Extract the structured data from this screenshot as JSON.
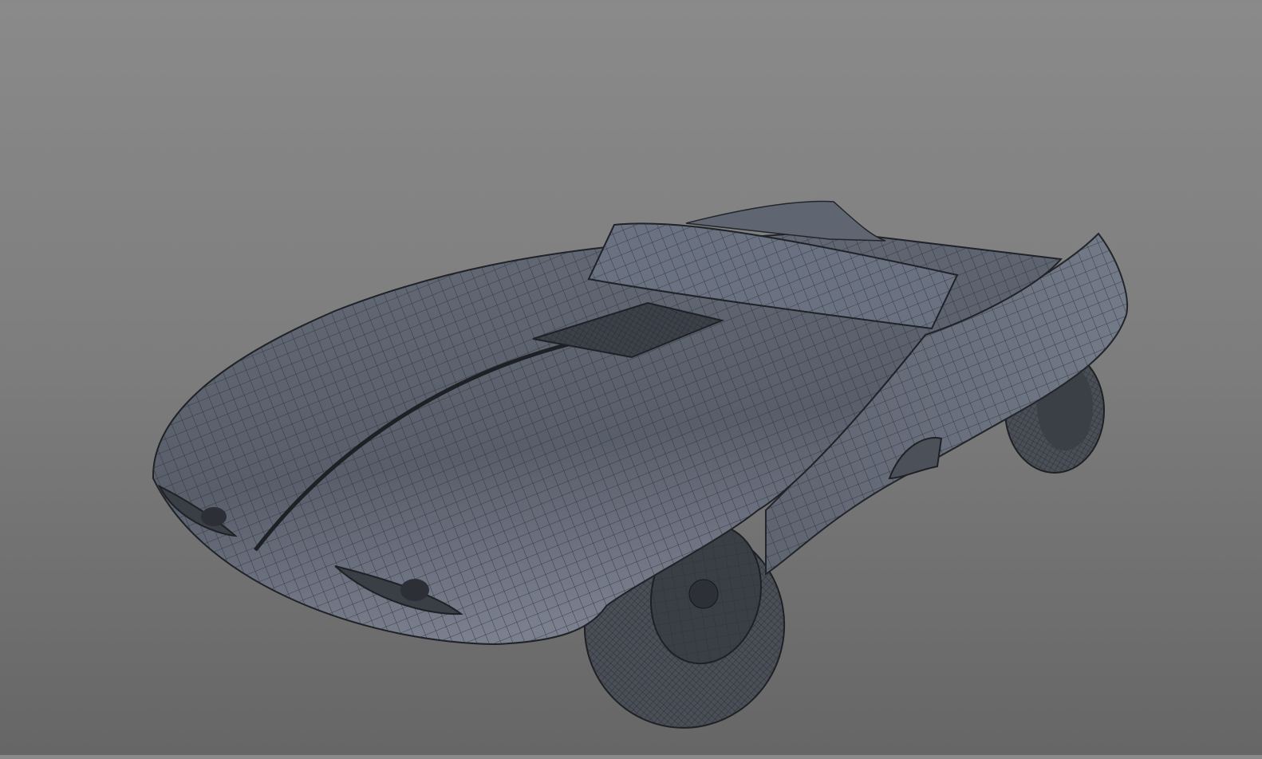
{
  "viewport": {
    "subject": "car-wireframe-model",
    "colors": {
      "background_top": "#8a8a8a",
      "background_bottom": "#666666",
      "surface": "#5d6370",
      "surface_light": "#7a8090",
      "wire": "#2a2d33",
      "tire": "#4a4e56"
    }
  }
}
